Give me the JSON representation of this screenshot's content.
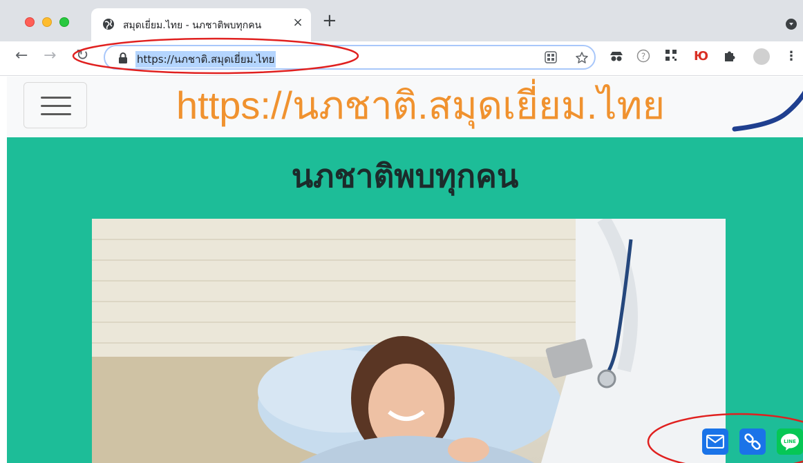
{
  "browser": {
    "tab": {
      "title": "สมุดเยี่ยม.ไทย - นภชาติพบทุกคน",
      "close_label": "×"
    },
    "new_tab_label": "+",
    "nav": {
      "back": "←",
      "forward": "→",
      "reload": "↻"
    },
    "address_bar": {
      "url": "https://นภชาติ.สมุดเยี่ยม.ไทย"
    },
    "omnibox_icons": [
      "qr-code-icon",
      "star-icon"
    ],
    "extensions": [
      "spy-icon",
      "help-circle-icon",
      "qr-code-icon",
      "yu-icon",
      "puzzle-icon",
      "profile-avatar",
      "more-icon"
    ],
    "extension_glyphs": {
      "yu": "Ю",
      "more": "⋮",
      "help": "?"
    }
  },
  "page": {
    "header": {
      "big_url": "https://นภชาติ.สมุดเยี่ยม.ไทย"
    },
    "title": "นภชาติพบทุกคน",
    "share_buttons": [
      "mail-icon",
      "link-icon",
      "line-icon"
    ],
    "line_label": "LINE"
  },
  "colors": {
    "accent_teal": "#1dbd98",
    "url_orange": "#f0922f",
    "annotation_red": "#e0201f",
    "arrow_blue": "#1f3f8f"
  }
}
